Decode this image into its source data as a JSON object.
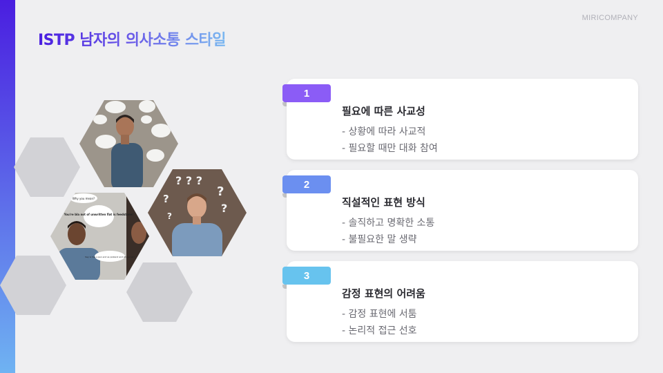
{
  "brand": "MIRICOMPANY",
  "title": "ISTP 남자의 의사소통 스타일",
  "colors": {
    "accent_top": "#4a1ee0",
    "accent_bottom": "#6fb3f2",
    "badge1": "#8b5cf6",
    "badge2": "#6b8ff0",
    "badge3": "#67c3ee"
  },
  "cards": [
    {
      "number": "1",
      "heading": "필요에 따른 사교성",
      "lines": [
        "- 상황에 따라 사교적",
        "- 필요할 때만 대화 참여"
      ]
    },
    {
      "number": "2",
      "heading": "직설적인 표현 방식",
      "lines": [
        "- 솔직하고 명확한 소통",
        "- 불필요한 말 생략"
      ]
    },
    {
      "number": "3",
      "heading": "감정 표현의 어려움",
      "lines": [
        "- 감정 표현에 서툼",
        "- 논리적 접근 선호"
      ]
    }
  ],
  "photos": {
    "photo1_icon": "man-with-speech-bubbles-photo",
    "photo2_icon": "man-with-question-marks-photo",
    "photo3_icon": "two-men-conversation-photo",
    "bubble1": "Why you mean?",
    "bubble2": "You're bla not of unwritten flat is feedstone!",
    "bubble3": "Say is has a pen end as pretend and Ah garnet!"
  }
}
